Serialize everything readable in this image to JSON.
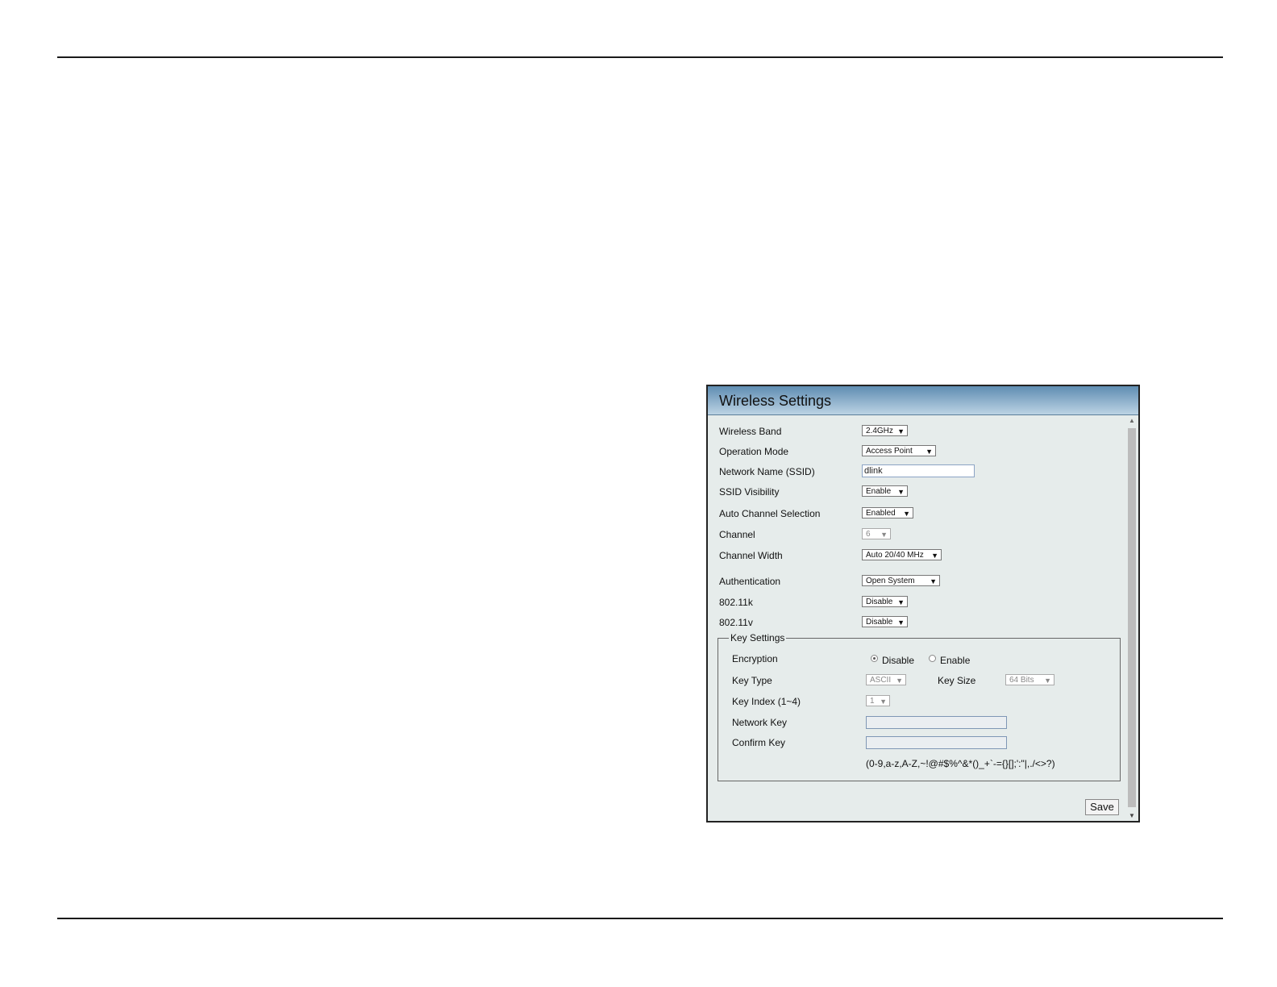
{
  "panel": {
    "title": "Wireless Settings"
  },
  "fields": {
    "wireless_band": {
      "label": "Wireless Band",
      "value": "2.4GHz"
    },
    "operation_mode": {
      "label": "Operation Mode",
      "value": "Access Point"
    },
    "ssid": {
      "label": "Network Name (SSID)",
      "value": "dlink"
    },
    "ssid_visibility": {
      "label": "SSID Visibility",
      "value": "Enable"
    },
    "auto_channel": {
      "label": "Auto Channel Selection",
      "value": "Enabled"
    },
    "channel": {
      "label": "Channel",
      "value": "6"
    },
    "channel_width": {
      "label": "Channel Width",
      "value": "Auto 20/40 MHz"
    },
    "authentication": {
      "label": "Authentication",
      "value": "Open System"
    },
    "dot11k": {
      "label": "802.11k",
      "value": "Disable"
    },
    "dot11v": {
      "label": "802.11v",
      "value": "Disable"
    }
  },
  "key_settings": {
    "legend": "Key Settings",
    "encryption": {
      "label": "Encryption",
      "disable_label": "Disable",
      "enable_label": "Enable",
      "selected": "Disable"
    },
    "key_type": {
      "label": "Key Type",
      "value": "ASCII"
    },
    "key_size": {
      "label": "Key Size",
      "value": "64 Bits"
    },
    "key_index": {
      "label": "Key Index (1~4)",
      "value": "1"
    },
    "network_key": {
      "label": "Network Key",
      "value": ""
    },
    "confirm_key": {
      "label": "Confirm Key",
      "value": ""
    },
    "hint": "(0-9,a-z,A-Z,~!@#$%^&*()_+`-={}[];':\"|,./<>?)"
  },
  "actions": {
    "save_label": "Save"
  }
}
